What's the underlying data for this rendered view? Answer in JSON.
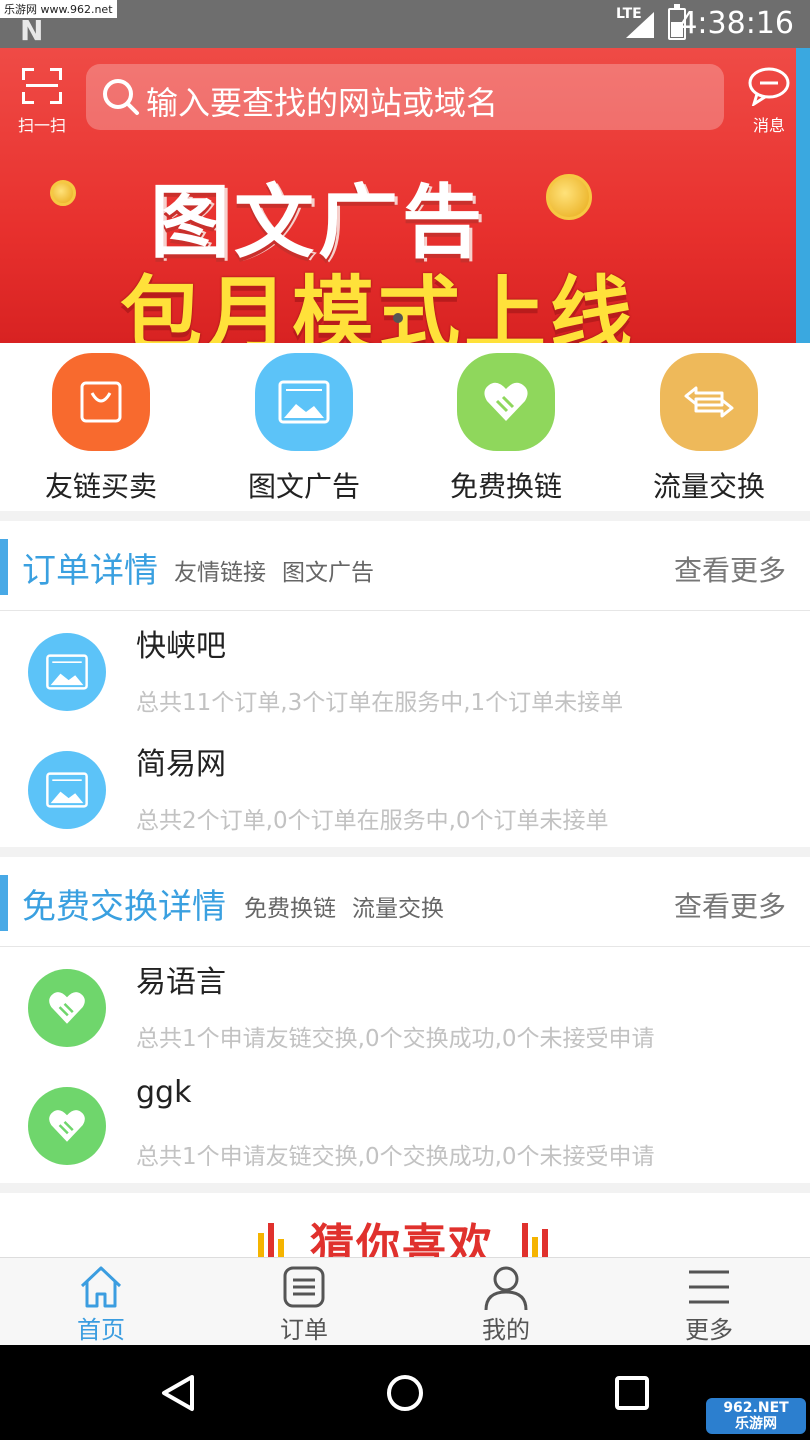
{
  "status_bar": {
    "watermark": "乐游网 www.962.net",
    "network": "LTE",
    "time": "4:38:16",
    "battery_level": 0.55
  },
  "header": {
    "scan_label": "扫一扫",
    "search_placeholder": "输入要查找的网站或域名",
    "message_label": "消息"
  },
  "banner": {
    "line1": "图文广告",
    "line2": "包月模式上线"
  },
  "quick_actions": [
    {
      "label": "友链买卖",
      "icon": "shopping-bag-icon",
      "color": "#f86a2e"
    },
    {
      "label": "图文广告",
      "icon": "image-icon",
      "color": "#5cc3f8"
    },
    {
      "label": "免费换链",
      "icon": "handshake-icon",
      "color": "#8fd75c"
    },
    {
      "label": "流量交换",
      "icon": "exchange-arrows-icon",
      "color": "#eeb95a"
    }
  ],
  "orders": {
    "title": "订单详情",
    "tags": [
      "友情链接",
      "图文广告"
    ],
    "more": "查看更多",
    "items": [
      {
        "name": "快峡吧",
        "desc": "总共11个订单,3个订单在服务中,1个订单未接单"
      },
      {
        "name": "简易网",
        "desc": "总共2个订单,0个订单在服务中,0个订单未接单"
      }
    ]
  },
  "exchange": {
    "title": "免费交换详情",
    "tags": [
      "免费换链",
      "流量交换"
    ],
    "more": "查看更多",
    "items": [
      {
        "name": "易语言",
        "desc": "总共1个申请友链交换,0个交换成功,0个未接受申请"
      },
      {
        "name": "ggk",
        "desc": "总共1个申请友链交换,0个交换成功,0个未接受申请"
      }
    ]
  },
  "guess": {
    "title": "猜你喜欢"
  },
  "tabs": [
    {
      "label": "首页",
      "icon": "home-icon",
      "active": true
    },
    {
      "label": "订单",
      "icon": "order-list-icon",
      "active": false
    },
    {
      "label": "我的",
      "icon": "user-icon",
      "active": false
    },
    {
      "label": "更多",
      "icon": "menu-icon",
      "active": false
    }
  ],
  "footer_watermark": {
    "line1": "962.NET",
    "line2": "乐游网"
  },
  "colors": {
    "accent": "#3b9de0",
    "banner_red": "#e8312e",
    "promo_yellow": "#ffe13a"
  }
}
